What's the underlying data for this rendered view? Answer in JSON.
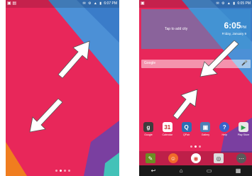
{
  "left": {
    "status": {
      "left_icons": "▣ ▤",
      "right_icons": "✉ ⚙ ▲ ▮",
      "time": "6:07 PM"
    },
    "page_dots": 4
  },
  "right": {
    "status": {
      "left_icons": "▣",
      "right_icons": "✉ ⚙ ▲ ▮",
      "time": "6:05 PM"
    },
    "widget": {
      "hint": "Tap to add city",
      "time": "6:05",
      "time_suffix": "PM",
      "date": "Friday, January 9"
    },
    "search": {
      "label": "Google",
      "mic_icon": "🎤"
    },
    "apps": [
      {
        "label": "Google",
        "glyph": "g",
        "color": "#3d3d3d"
      },
      {
        "label": "Calendar",
        "glyph": "31",
        "color": "#ffffff"
      },
      {
        "label": "QPair",
        "glyph": "Q",
        "color": "#2b6fb3"
      },
      {
        "label": "Gallery",
        "glyph": "▣",
        "color": "#4a7fb5"
      },
      {
        "label": "Help",
        "glyph": "?",
        "color": "#3a62c8"
      },
      {
        "label": "Play Store",
        "glyph": "▶",
        "color": "#e8e8e8"
      }
    ],
    "dock": [
      {
        "name": "notes",
        "glyph": "✎",
        "color": "#6b8e23"
      },
      {
        "name": "contacts",
        "glyph": "☺",
        "color": "#f06a2a"
      },
      {
        "name": "chrome",
        "glyph": "◉",
        "color": "#ffffff"
      },
      {
        "name": "camera",
        "glyph": "◎",
        "color": "#dddddd"
      },
      {
        "name": "apps",
        "glyph": "⋯",
        "color": "#5a5a5a"
      }
    ],
    "nav": {
      "back": "↩",
      "home": "⌂",
      "recent": "▭",
      "extra": "▦"
    },
    "page_dots": 3
  },
  "colors": {
    "pink": "#e8275a",
    "arrow_fill": "#ffffff",
    "arrow_stroke": "#555555"
  }
}
